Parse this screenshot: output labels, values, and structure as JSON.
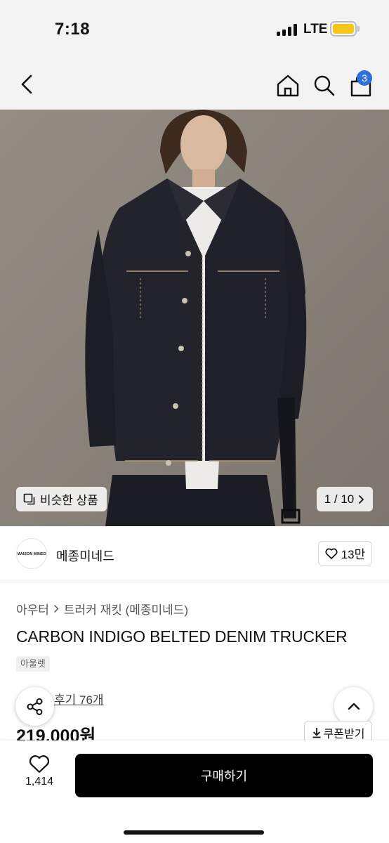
{
  "status_bar": {
    "time": "7:18",
    "network": "LTE"
  },
  "header": {
    "back_icon": "chevron-left-icon",
    "home_icon": "home-icon",
    "search_icon": "search-icon",
    "cart_icon": "shopping-bag-icon",
    "cart_badge": "3",
    "badge_color": "#2f6fdc"
  },
  "hero": {
    "similar_label": "비슷한 상품",
    "pager": "1 / 10"
  },
  "brand": {
    "logo_text": "MAISON MINED",
    "name": "메종미네드",
    "likes": "13만"
  },
  "product": {
    "breadcrumb": [
      "아우터",
      "트러커 재킷 (메종미네드)"
    ],
    "title": "CARBON INDIGO BELTED DENIM TRUCKER",
    "tag": "아울렛",
    "review_link": "후기 76개",
    "price": "219,000원",
    "coupon_label": "쿠폰받기"
  },
  "bottom_bar": {
    "wish_count": "1,414",
    "buy_label": "구매하기"
  }
}
